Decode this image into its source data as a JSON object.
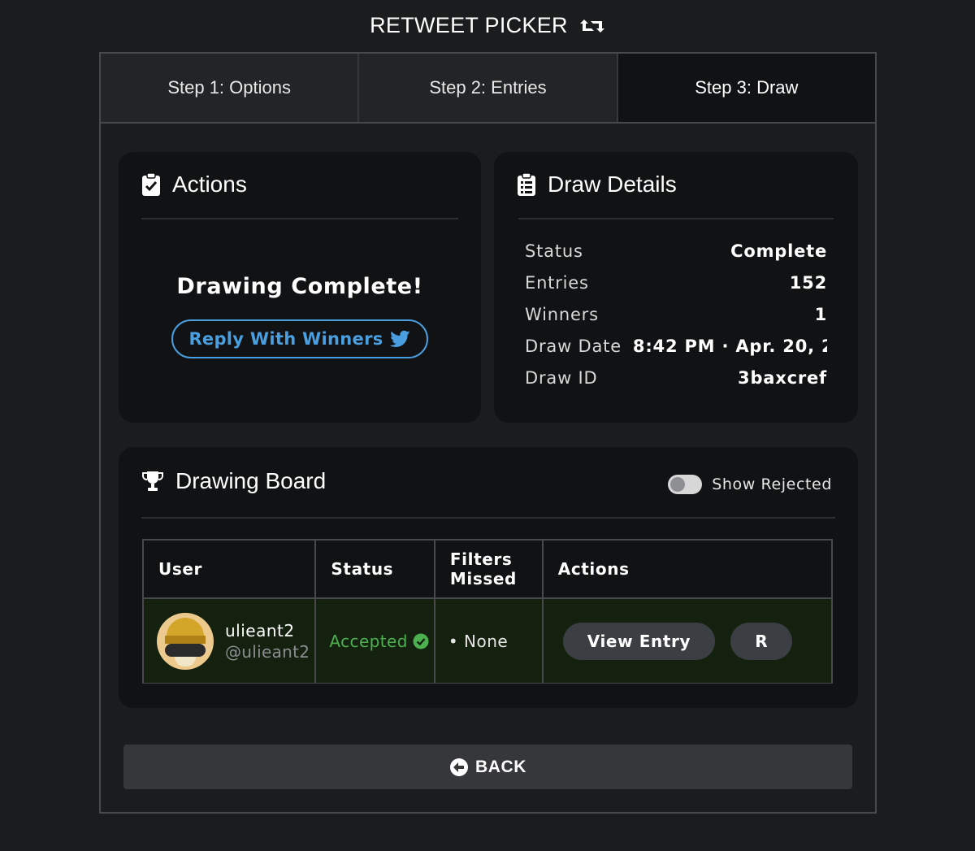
{
  "app": {
    "title": "RETWEET PICKER",
    "title_icon": "retweet-icon"
  },
  "tabs": [
    {
      "label": "Step 1: Options",
      "active": false
    },
    {
      "label": "Step 2: Entries",
      "active": false
    },
    {
      "label": "Step 3: Draw",
      "active": true
    }
  ],
  "actions_card": {
    "title": "Actions",
    "icon": "clipboard-check-icon",
    "message": "Drawing Complete!",
    "reply_button": "Reply With Winners",
    "reply_icon": "twitter-bird-icon"
  },
  "details_card": {
    "title": "Draw Details",
    "icon": "clipboard-list-icon",
    "rows": [
      {
        "label": "Status",
        "value": "Complete"
      },
      {
        "label": "Entries",
        "value": "152"
      },
      {
        "label": "Winners",
        "value": "1"
      },
      {
        "label": "Draw Date",
        "value": "8:42 PM · Apr. 20, 2"
      },
      {
        "label": "Draw ID",
        "value": "3baxcref"
      }
    ]
  },
  "board_card": {
    "title": "Drawing Board",
    "icon": "trophy-icon",
    "toggle_label": "Show Rejected",
    "toggle_on": false,
    "columns": [
      "User",
      "Status",
      "Filters Missed",
      "Actions"
    ],
    "rows": [
      {
        "name": "ulieant2",
        "handle": "@ulieant2",
        "status": "Accepted",
        "filters": "• None",
        "actions": [
          "View Entry",
          "R"
        ]
      }
    ]
  },
  "back_button": {
    "label": "BACK",
    "icon": "arrow-circle-left-icon"
  },
  "colors": {
    "background": "#1b1c1e",
    "card": "#111213",
    "accent_blue": "#4a9fe0",
    "accepted_green": "#4caf50",
    "row_highlight": "#15210f"
  }
}
